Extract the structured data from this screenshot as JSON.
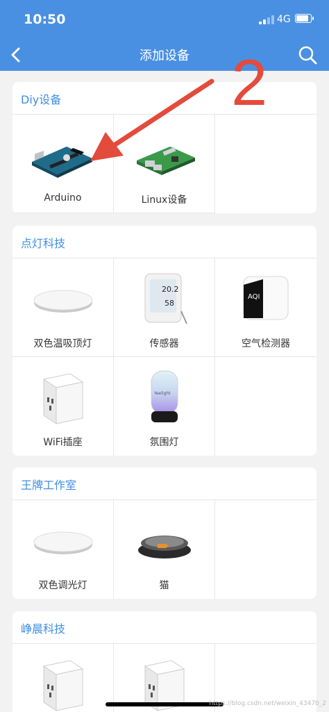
{
  "status": {
    "time": "10:50",
    "network": "4G",
    "battery_level": 0.9
  },
  "nav": {
    "title": "添加设备",
    "back_icon": "chevron-left-icon",
    "search_icon": "search-icon"
  },
  "sections": [
    {
      "title": "Diy设备",
      "items": [
        {
          "label": "Arduino",
          "icon": "arduino-board"
        },
        {
          "label": "Linux设备",
          "icon": "raspberry-pi-board"
        }
      ]
    },
    {
      "title": "点灯科技",
      "items": [
        {
          "label": "双色温吸顶灯",
          "icon": "ceiling-light"
        },
        {
          "label": "传感器",
          "icon": "sensor-display"
        },
        {
          "label": "空气检测器",
          "icon": "air-quality-monitor"
        },
        {
          "label": "WiFi插座",
          "icon": "smart-socket"
        },
        {
          "label": "氛围灯",
          "icon": "ambient-lamp"
        }
      ]
    },
    {
      "title": "王牌工作室",
      "items": [
        {
          "label": "双色调光灯",
          "icon": "ceiling-light"
        },
        {
          "label": "猫",
          "icon": "pet-bowl"
        }
      ]
    },
    {
      "title": "峥晨科技",
      "items": [
        {
          "label": "",
          "icon": "smart-socket"
        },
        {
          "label": "",
          "icon": "smart-socket"
        }
      ]
    }
  ],
  "device_screens": {
    "sensor_top": "20.2",
    "sensor_bottom": "58",
    "aqi": "AQI",
    "lamp_brand": "Yeelight"
  },
  "annotation": {
    "number": "2",
    "color": "#e34b3c"
  },
  "watermark": "https://blog.csdn.net/weixin_43470_2",
  "colors": {
    "primary": "#4a90e2",
    "section_title": "#3e8ee3"
  }
}
